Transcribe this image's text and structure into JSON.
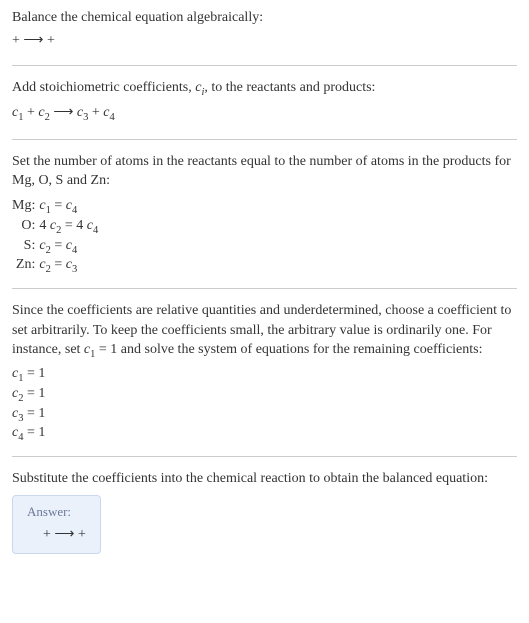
{
  "step1": {
    "text": "Balance the chemical equation algebraically:",
    "equation": " +  ⟶  + "
  },
  "step2": {
    "text_before": "Add stoichiometric coefficients, ",
    "ci": "c",
    "ci_sub": "i",
    "text_after": ", to the reactants and products:",
    "eq_c1": "c",
    "eq_c1s": "1",
    "eq_plus1": " + ",
    "eq_c2": "c",
    "eq_c2s": "2",
    "eq_arrow": "  ⟶ ",
    "eq_c3": "c",
    "eq_c3s": "3",
    "eq_plus2": " + ",
    "eq_c4": "c",
    "eq_c4s": "4"
  },
  "step3": {
    "text": "Set the number of atoms in the reactants equal to the number of atoms in the products for Mg, O, S and Zn:",
    "rows": {
      "mg_label": "Mg:",
      "mg_lhs_c": "c",
      "mg_lhs_s": "1",
      "mg_eq": " = ",
      "mg_rhs_c": "c",
      "mg_rhs_s": "4",
      "o_label": "O:",
      "o_lhs_n": "4 ",
      "o_lhs_c": "c",
      "o_lhs_s": "2",
      "o_eq": " = ",
      "o_rhs_n": "4 ",
      "o_rhs_c": "c",
      "o_rhs_s": "4",
      "s_label": "S:",
      "s_lhs_c": "c",
      "s_lhs_s": "2",
      "s_eq": " = ",
      "s_rhs_c": "c",
      "s_rhs_s": "4",
      "zn_label": "Zn:",
      "zn_lhs_c": "c",
      "zn_lhs_s": "2",
      "zn_eq": " = ",
      "zn_rhs_c": "c",
      "zn_rhs_s": "3"
    }
  },
  "step4": {
    "text_before": "Since the coefficients are relative quantities and underdetermined, choose a coefficient to set arbitrarily. To keep the coefficients small, the arbitrary value is ordinarily one. For instance, set ",
    "c1": "c",
    "c1s": "1",
    "text_mid": " = 1 and solve the system of equations for the remaining coefficients:",
    "coeffs": {
      "l1c": "c",
      "l1s": "1",
      "l1v": " = 1",
      "l2c": "c",
      "l2s": "2",
      "l2v": " = 1",
      "l3c": "c",
      "l3s": "3",
      "l3v": " = 1",
      "l4c": "c",
      "l4s": "4",
      "l4v": " = 1"
    }
  },
  "step5": {
    "text": "Substitute the coefficients into the chemical reaction to obtain the balanced equation:"
  },
  "answer": {
    "label": "Answer:",
    "equation": " +  ⟶  + "
  }
}
